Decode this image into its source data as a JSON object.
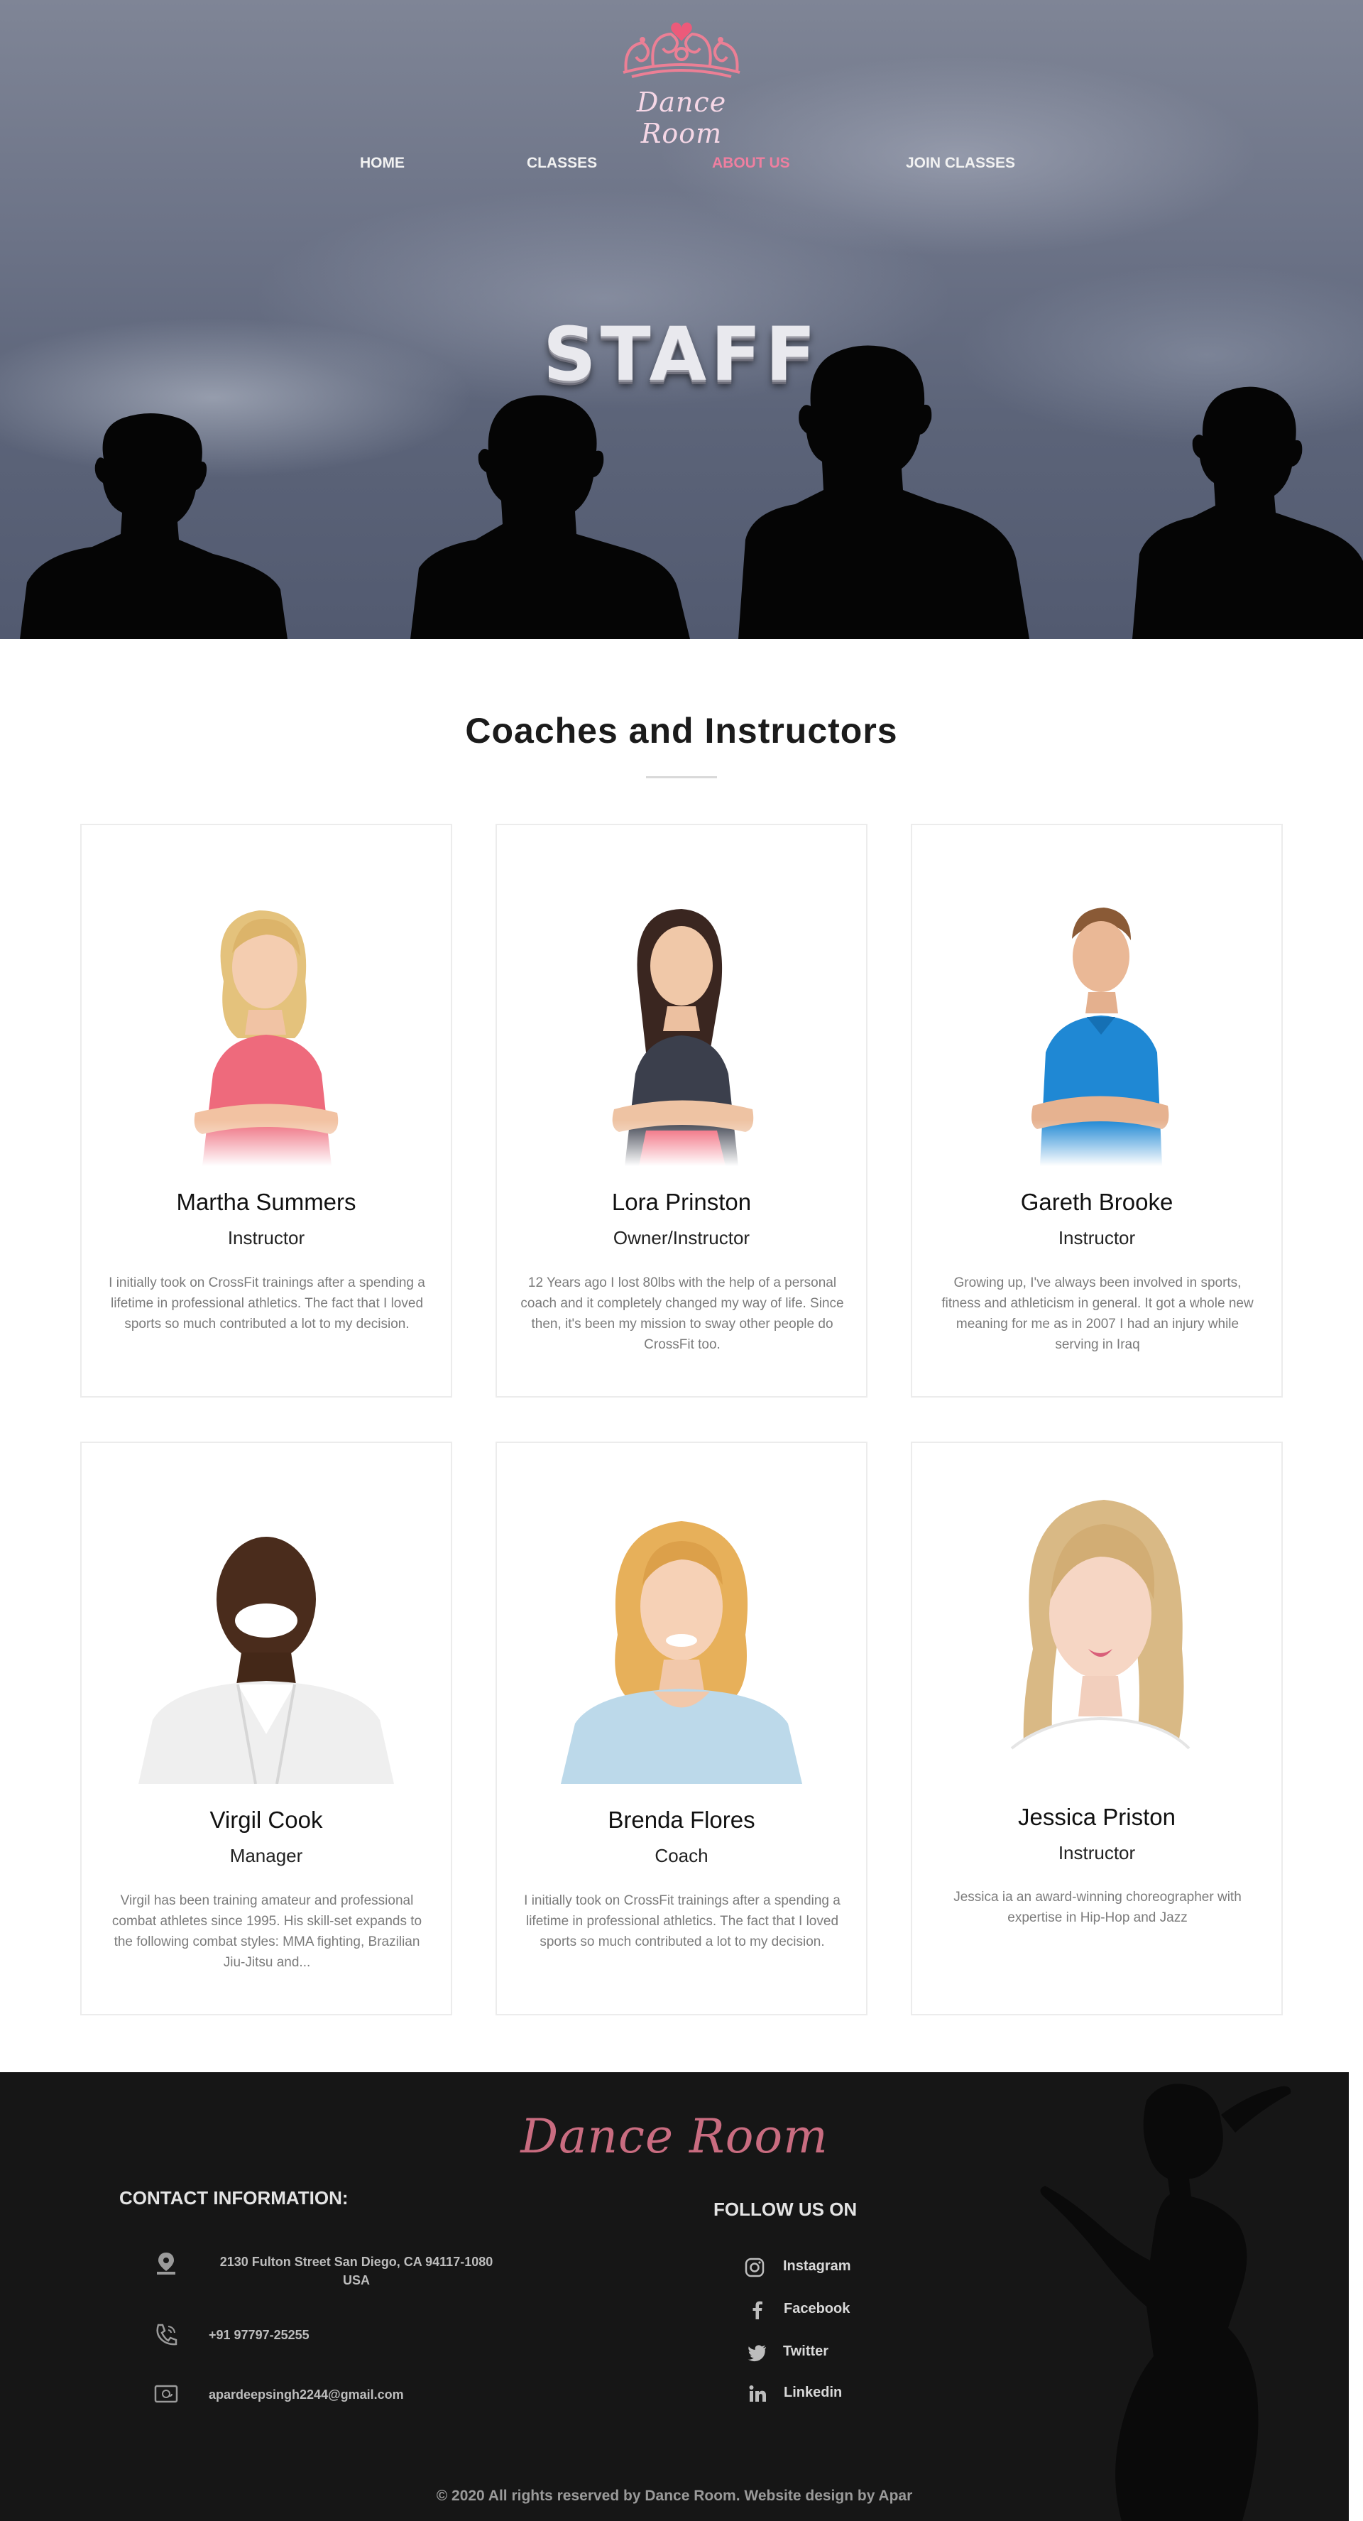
{
  "brand": {
    "name": "Dance Room",
    "accent": "#ef7fa0",
    "logo_icon": "crown-icon"
  },
  "nav": {
    "items": [
      {
        "label": "HOME",
        "active": false
      },
      {
        "label": "CLASSES",
        "active": false
      },
      {
        "label": "ABOUT US",
        "active": true
      },
      {
        "label": "JOIN CLASSES",
        "active": false
      }
    ]
  },
  "hero": {
    "title": "STAFF"
  },
  "staff": {
    "heading": "Coaches and Instructors",
    "members": [
      {
        "name": "Martha Summers",
        "role": "Instructor",
        "bio": "I initially took on CrossFit trainings after a spending a lifetime in professional athletics. The fact that I loved sports so much contributed a lot to my decision."
      },
      {
        "name": "Lora Prinston",
        "role": "Owner/Instructor",
        "bio": "12 Years ago I lost 80lbs with the help of a personal coach and it completely changed my way of life. Since then, it's been my mission to sway other people do CrossFit too."
      },
      {
        "name": "Gareth Brooke",
        "role": "Instructor",
        "bio": "Growing up, I've always been involved in sports, fitness and athleticism in general. It got a whole new meaning for me as in 2007 I had an injury while serving in Iraq"
      },
      {
        "name": "Virgil Cook",
        "role": "Manager",
        "bio": "Virgil has been training amateur and professional combat athletes since 1995. His skill-set expands to the following combat styles: MMA fighting, Brazilian Jiu-Jitsu and..."
      },
      {
        "name": "Brenda Flores",
        "role": "Coach",
        "bio": "I initially took on CrossFit trainings after a spending a lifetime in professional athletics. The fact that I loved sports so much contributed a lot to my decision."
      },
      {
        "name": "Jessica Priston",
        "role": "Instructor",
        "bio": "Jessica ia an award-winning choreographer with expertise in Hip-Hop and Jazz"
      }
    ]
  },
  "footer": {
    "logo": "Dance Room",
    "contact_title": "CONTACT INFORMATION:",
    "address": "2130 Fulton Street San Diego, CA 94117-1080 USA",
    "phone": "+91 97797-25255",
    "email": "apardeepsingh2244@gmail.com",
    "follow_title": "FOLLOW US ON",
    "social": [
      {
        "label": "Instagram",
        "icon": "instagram-icon"
      },
      {
        "label": "Facebook",
        "icon": "facebook-icon"
      },
      {
        "label": "Twitter",
        "icon": "twitter-icon"
      },
      {
        "label": "Linkedin",
        "icon": "linkedin-icon"
      }
    ],
    "copyright": "© 2020 All rights reserved by Dance Room. Website design by Apar"
  }
}
